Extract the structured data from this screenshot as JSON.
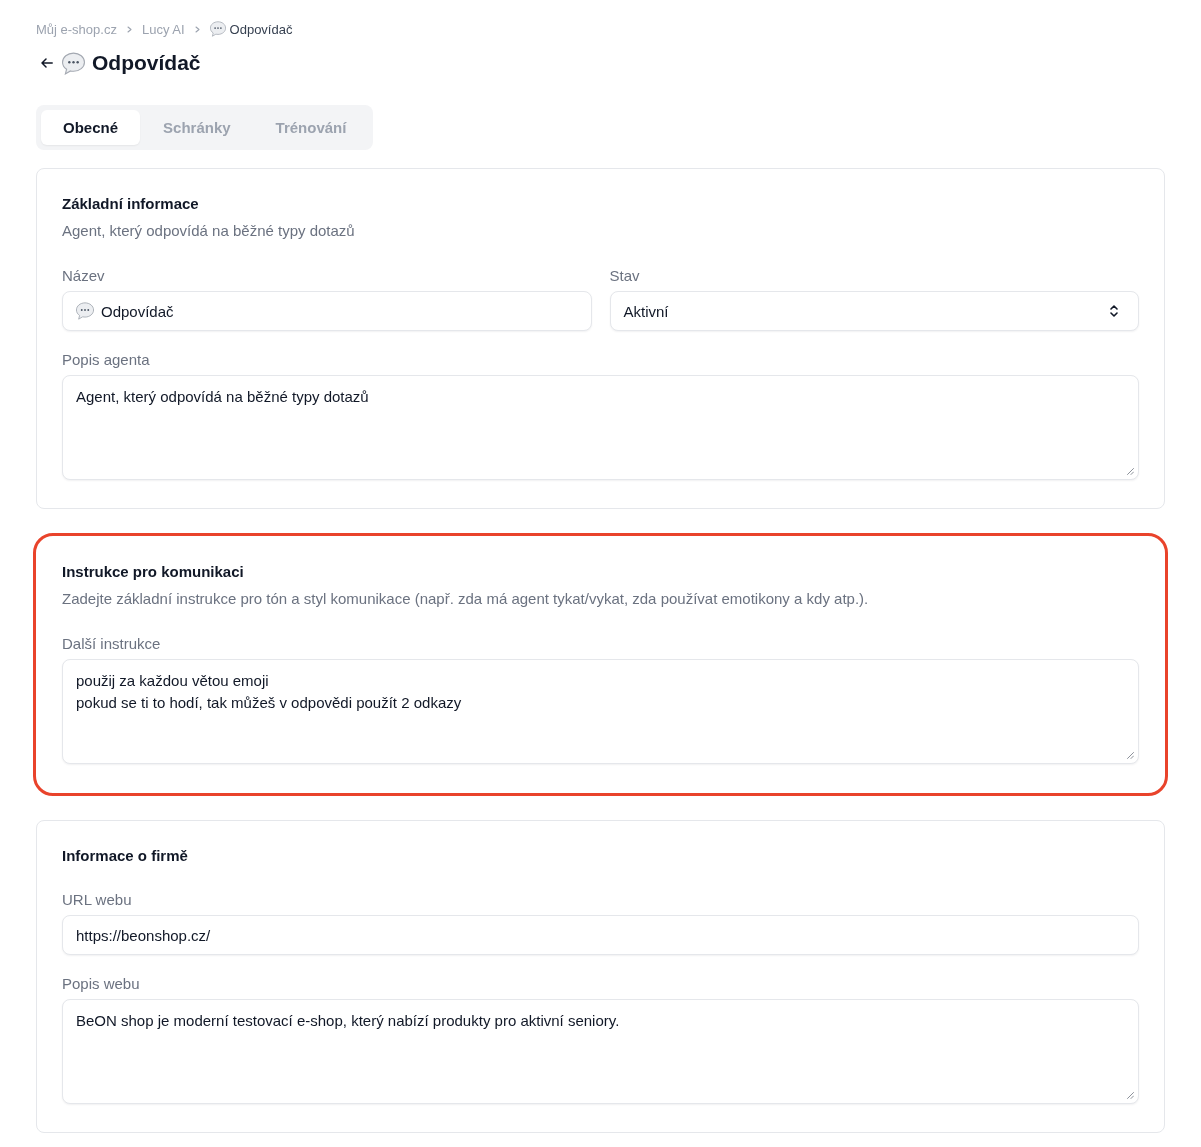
{
  "breadcrumb": [
    {
      "kind": "plain",
      "label": "Můj e-shop.cz",
      "current": false
    },
    {
      "kind": "plain",
      "label": "Lucy AI",
      "current": false
    },
    {
      "kind": "with-icon",
      "label": "Odpovídač",
      "current": true
    }
  ],
  "header": {
    "title": "Odpovídač"
  },
  "tabs": [
    {
      "label": "Obecné",
      "selected": true
    },
    {
      "label": "Schránky",
      "selected": false
    },
    {
      "label": "Trénování",
      "selected": false
    }
  ],
  "sections": [
    {
      "title": "Základní informace",
      "description": "Agent, který odpovídá na běžné typy dotazů",
      "highlighted": false,
      "rows": [
        {
          "fields": [
            {
              "kind": "icon-text",
              "label": "Název",
              "value": "Odpovídač"
            },
            {
              "kind": "select",
              "label": "Stav",
              "value": "Aktivní"
            }
          ]
        },
        {
          "fields": [
            {
              "kind": "textarea",
              "label": "Popis agenta",
              "value": "Agent, který odpovídá na běžné typy dotazů"
            }
          ]
        }
      ]
    },
    {
      "title": "Instrukce pro komunikaci",
      "description": "Zadejte základní instrukce pro tón a styl komunikace (např. zda má agent tykat/vykat, zda používat emotikony a kdy atp.).",
      "highlighted": true,
      "rows": [
        {
          "fields": [
            {
              "kind": "textarea",
              "label": "Další instrukce",
              "value": "použij za každou větou emoji\npokud se ti to hodí, tak můžeš v odpovědi použít 2 odkazy"
            }
          ]
        }
      ]
    },
    {
      "title": "Informace o firmě",
      "highlighted": false,
      "rows": [
        {
          "fields": [
            {
              "kind": "text",
              "label": "URL webu",
              "value": "https://beonshop.cz/"
            }
          ]
        },
        {
          "fields": [
            {
              "kind": "textarea",
              "label": "Popis webu",
              "value": "BeON shop je moderní testovací e-shop, který nabízí produkty pro aktivní seniory."
            }
          ]
        }
      ]
    }
  ]
}
